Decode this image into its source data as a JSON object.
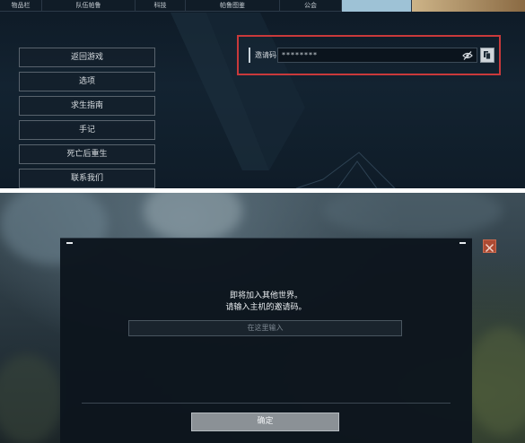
{
  "top": {
    "tabs": [
      {
        "label": "物品栏",
        "active": false
      },
      {
        "label": "队伍帕鲁",
        "active": false
      },
      {
        "label": "科技",
        "active": false
      },
      {
        "label": "帕鲁图鉴",
        "active": false
      },
      {
        "label": "公会",
        "active": false
      },
      {
        "label": "",
        "active": true
      },
      {
        "label": "",
        "active": false
      }
    ],
    "notice": "",
    "menu": [
      "返回游戏",
      "选项",
      "求生指南",
      "手记",
      "死亡后重生",
      "联系我们"
    ],
    "invite": {
      "label": "邀请码",
      "masked_value": "********"
    }
  },
  "dialog": {
    "line1": "即将加入其他世界。",
    "line2": "请输入主机的邀请码。",
    "input_placeholder": "在这里输入",
    "confirm_label": "确定"
  },
  "colors": {
    "highlight_border": "#c9393b",
    "dialog_bg": "#0d151d",
    "close_button": "#ad4a33"
  }
}
